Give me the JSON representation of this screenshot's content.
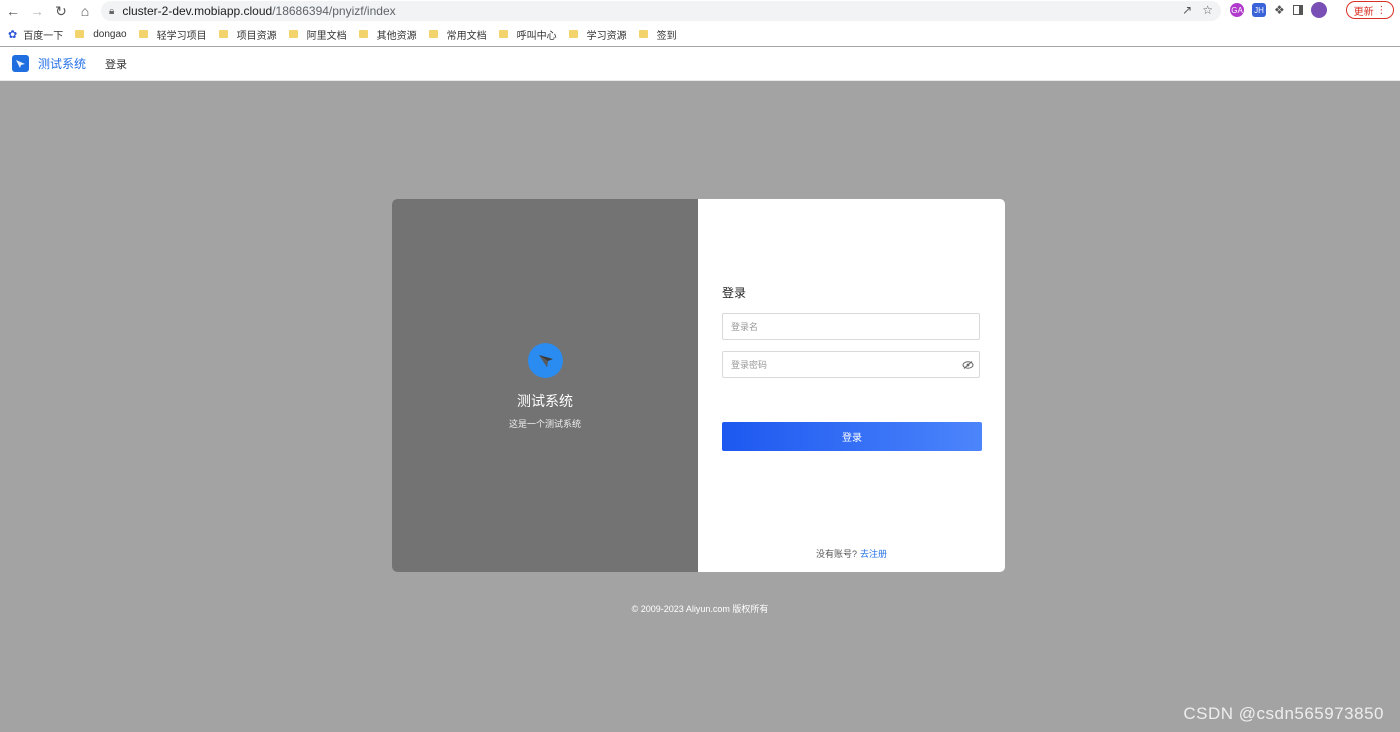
{
  "browser": {
    "url_host": "cluster-2-dev.mobiapp.cloud",
    "url_path": "/18686394/pnyizf/index",
    "update_label": "更新",
    "ext_labels": [
      "GA",
      "JH"
    ]
  },
  "bookmarks": [
    {
      "label": "百度一下",
      "icon": "baidu-icon"
    },
    {
      "label": "dongao",
      "icon": "folder-icon"
    },
    {
      "label": "轻学习项目",
      "icon": "folder-icon"
    },
    {
      "label": "项目资源",
      "icon": "folder-icon"
    },
    {
      "label": "阿里文档",
      "icon": "folder-icon"
    },
    {
      "label": "其他资源",
      "icon": "folder-icon"
    },
    {
      "label": "常用文档",
      "icon": "folder-icon"
    },
    {
      "label": "呼叫中心",
      "icon": "folder-icon"
    },
    {
      "label": "学习资源",
      "icon": "folder-icon"
    },
    {
      "label": "签到",
      "icon": "folder-icon"
    }
  ],
  "header": {
    "app_title": "测试系统",
    "nav_login": "登录"
  },
  "brand": {
    "name": "测试系统",
    "subtitle": "这是一个测试系统"
  },
  "form": {
    "title": "登录",
    "username_placeholder": "登录名",
    "password_placeholder": "登录密码",
    "submit_label": "登录",
    "no_account_text": "没有账号?",
    "register_link": "去注册"
  },
  "footer": {
    "copyright": "© 2009-2023 Aliyun.com 版权所有"
  },
  "watermark": "CSDN @csdn565973850",
  "colors": {
    "accent": "#2470e6",
    "button_start": "#1d58f0",
    "button_end": "#4c85fb",
    "left_panel": "#737373",
    "backdrop": "#a3a3a3"
  }
}
